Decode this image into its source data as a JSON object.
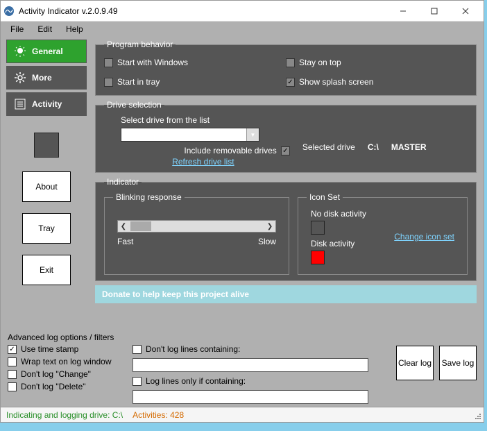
{
  "titlebar": {
    "title": "Activity Indicator v.2.0.9.49"
  },
  "menu": {
    "file": "File",
    "edit": "Edit",
    "help": "Help"
  },
  "tabs": {
    "general": "General",
    "more": "More",
    "activity": "Activity"
  },
  "sidebuttons": {
    "about": "About",
    "tray": "Tray",
    "exit": "Exit"
  },
  "program_behavior": {
    "legend": "Program behavior",
    "start_windows": "Start with Windows",
    "start_tray": "Start in tray",
    "stay_on_top": "Stay on top",
    "splash": "Show splash screen"
  },
  "drive_selection": {
    "legend": "Drive selection",
    "select_label": "Select drive from the list",
    "include_removable": "Include removable drives",
    "refresh": "Refresh drive list",
    "selected_label": "Selected drive",
    "selected_drive": "C:\\",
    "selected_name": "MASTER"
  },
  "indicator": {
    "legend": "Indicator",
    "blinking_legend": "Blinking response",
    "fast": "Fast",
    "slow": "Slow",
    "iconset_legend": "Icon Set",
    "no_activity": "No disk activity",
    "activity": "Disk activity",
    "change_icon": "Change icon set",
    "colors": {
      "no_activity": "#555555",
      "activity": "#ff0000"
    }
  },
  "donate": "Donate to help keep this project alive",
  "advanced": {
    "title": "Advanced log options / filters",
    "use_timestamp": "Use time stamp",
    "wrap_text": "Wrap text on log window",
    "dont_log_change": "Don't log \"Change\"",
    "dont_log_delete": "Don't log \"Delete\"",
    "dont_log_containing": "Don't log lines containing:",
    "only_if_containing": "Log lines only if containing:",
    "clear_log": "Clear log",
    "save_log": "Save log"
  },
  "status": {
    "indicating": "Indicating and logging  drive: C:\\",
    "activities": "Activities: 428"
  }
}
